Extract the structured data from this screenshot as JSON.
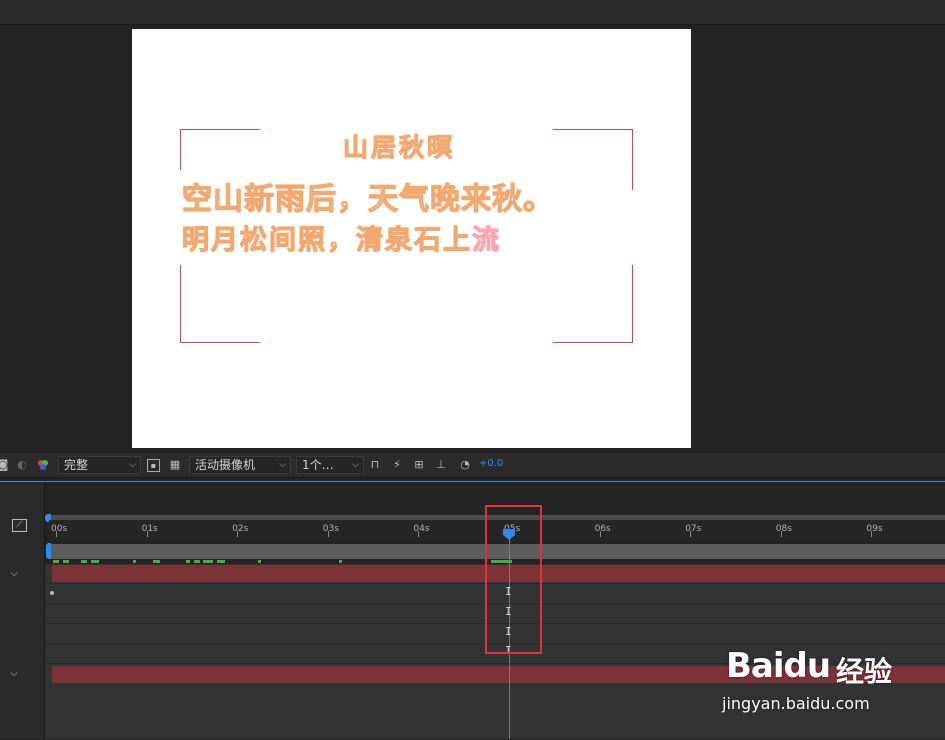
{
  "composition": {
    "title_line": "山居秋暝",
    "line1": "空山新雨后，天气晚来秋。",
    "line2_main": "明月松间照，清泉石上",
    "line2_glow": "流"
  },
  "viewer_bar": {
    "resolution": "完整",
    "camera": "活动摄像机",
    "views": "1个…",
    "exposure": "+0.0"
  },
  "timeline": {
    "ruler_labels": [
      "00s",
      "01s",
      "02s",
      "03s",
      "04s",
      "05s",
      "06s",
      "07s",
      "08s",
      "09s"
    ]
  },
  "watermark": {
    "brand": "Baidu",
    "brand_cn": "经验",
    "url": "jingyan.baidu.com"
  },
  "colors": {
    "accent": "#2d8ceb",
    "highlight_box": "#e0333b",
    "layer_bar": "#7b3337",
    "keyframe_green": "#3bb34a",
    "text_stroke": "#f2a971"
  }
}
